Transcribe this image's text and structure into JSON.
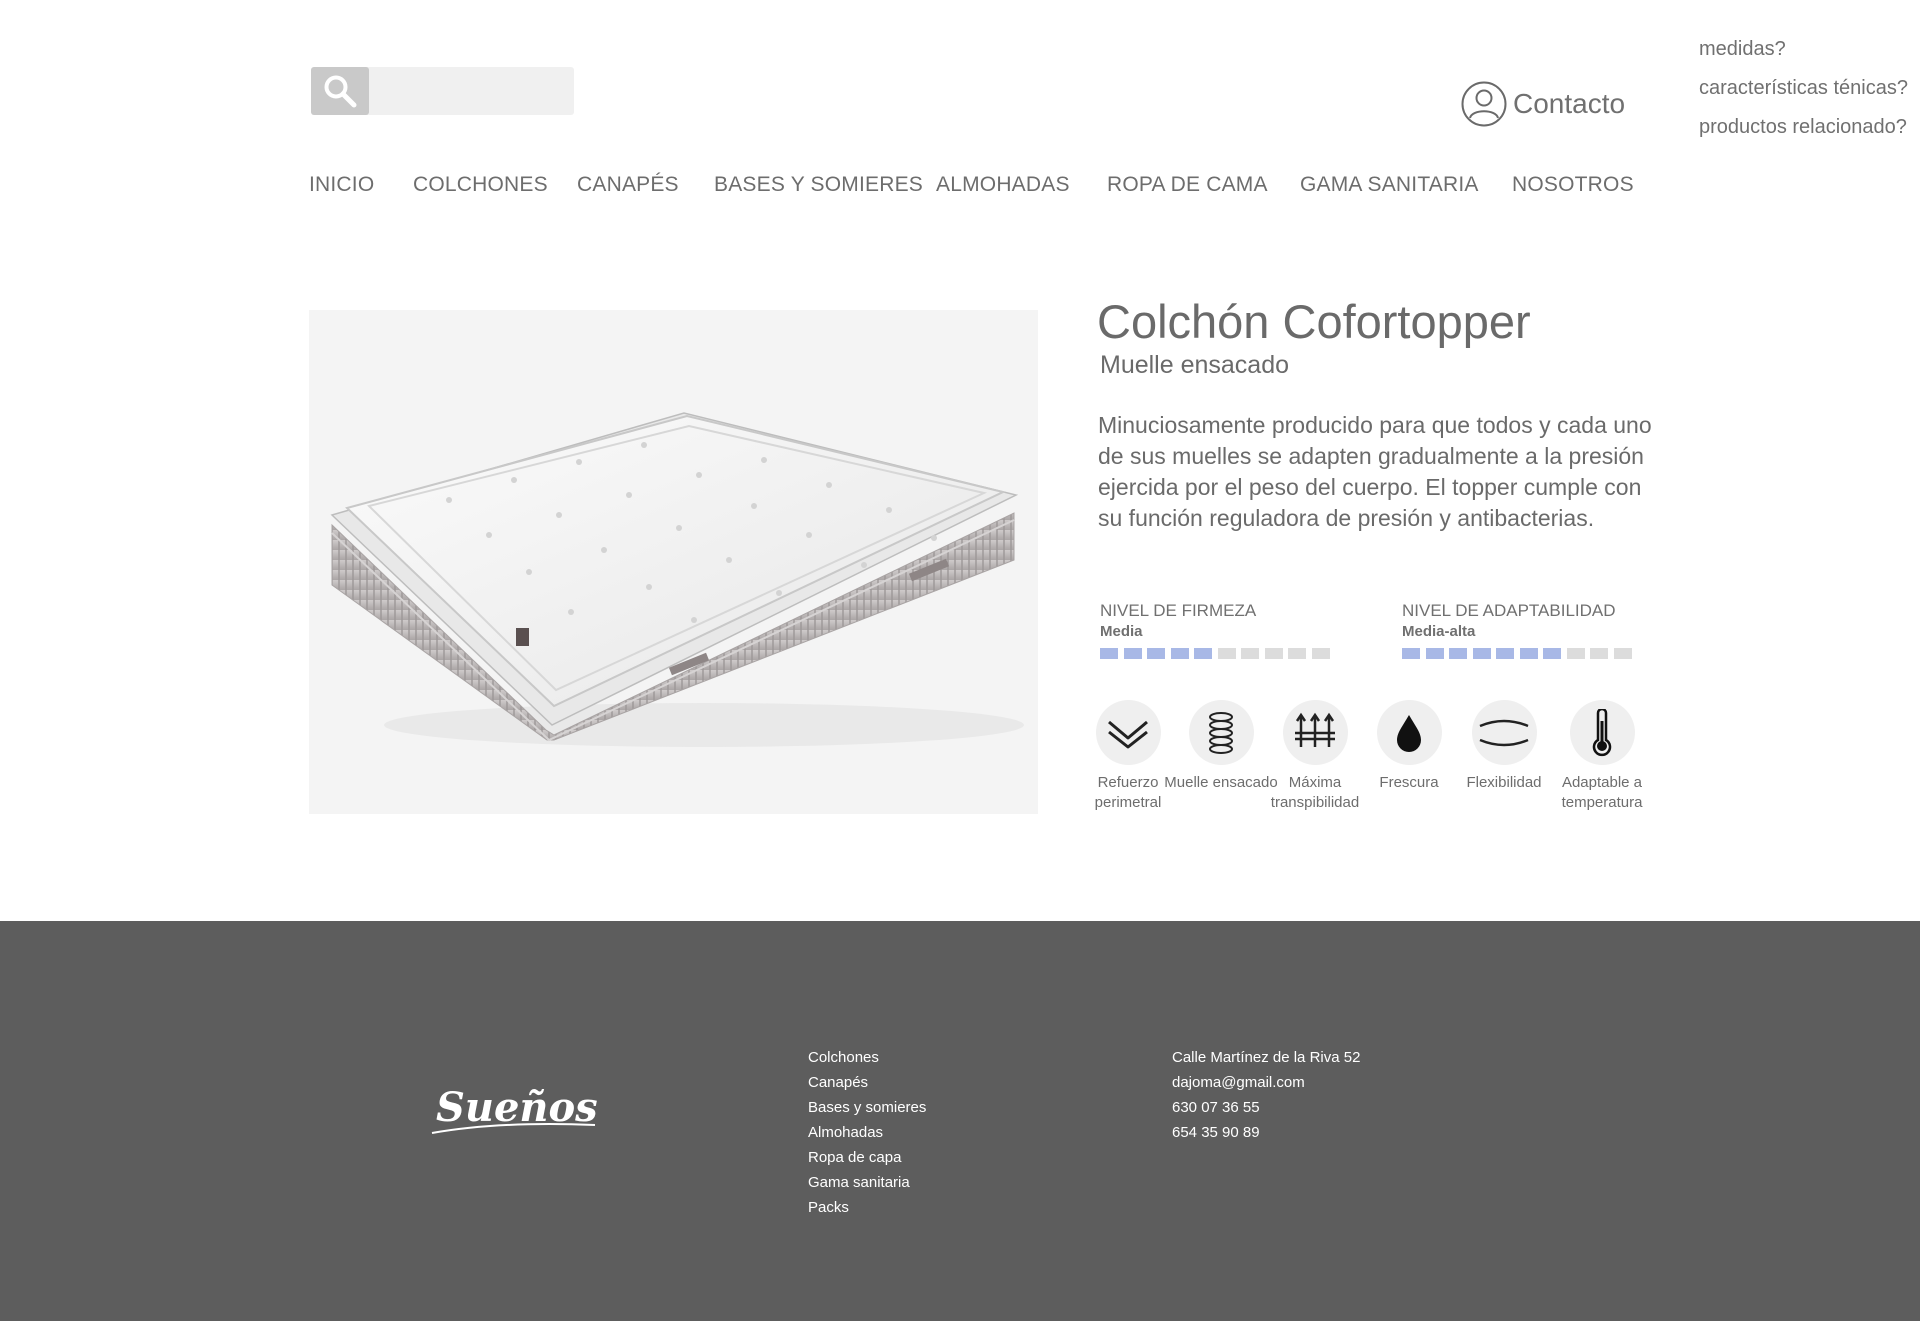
{
  "header": {
    "search": {
      "placeholder": ""
    },
    "contact_label": "Contacto",
    "side_links": [
      "medidas?",
      "características ténicas?",
      "productos relacionado?"
    ]
  },
  "nav": {
    "items": [
      "INICIO",
      "COLCHONES",
      "CANAPÉS",
      "BASES Y SOMIERES",
      "ALMOHADAS",
      "ROPA DE CAMA",
      "GAMA SANITARIA",
      "NOSOTROS"
    ]
  },
  "product": {
    "title": "Colchón Cofortopper",
    "subtitle": "Muelle ensacado",
    "description": "Minuciosamente producido para que todos y cada uno de sus muelles se adapten gradualmente a la presión ejercida por el peso del cuerpo. El topper cumple con su función reguladora de presión y antibacterias.",
    "firmness": {
      "label": "NIVEL DE FIRMEZA",
      "value": "Media",
      "level": 5,
      "max": 10
    },
    "adaptability": {
      "label": "NIVEL DE ADAPTABILIDAD",
      "value": "Media-alta",
      "level": 7,
      "max": 10
    },
    "features": [
      {
        "icon": "chevron-double-down-icon",
        "label": "Refuerzo perimetral"
      },
      {
        "icon": "spring-coil-icon",
        "label": "Muelle ensacado"
      },
      {
        "icon": "arrows-up-icon",
        "label": "Máxima transpibilidad"
      },
      {
        "icon": "water-drop-icon",
        "label": "Frescura"
      },
      {
        "icon": "flex-curves-icon",
        "label": "Flexibilidad"
      },
      {
        "icon": "thermometer-icon",
        "label": "Adaptable a temperatura"
      }
    ]
  },
  "footer": {
    "logo_text": "Sueños",
    "links": [
      "Colchones",
      "Canapés",
      "Bases y somieres",
      "Almohadas",
      "Ropa de capa",
      "Gama sanitaria",
      "Packs"
    ],
    "contact": [
      "Calle Martínez de la Riva 52",
      "dajoma@gmail.com",
      "630 07 36 55",
      "654 35 90 89"
    ]
  },
  "colors": {
    "rating_on": "#a8b8e6",
    "rating_off": "#dcdcdc",
    "footer_bg": "#5d5d5d"
  }
}
